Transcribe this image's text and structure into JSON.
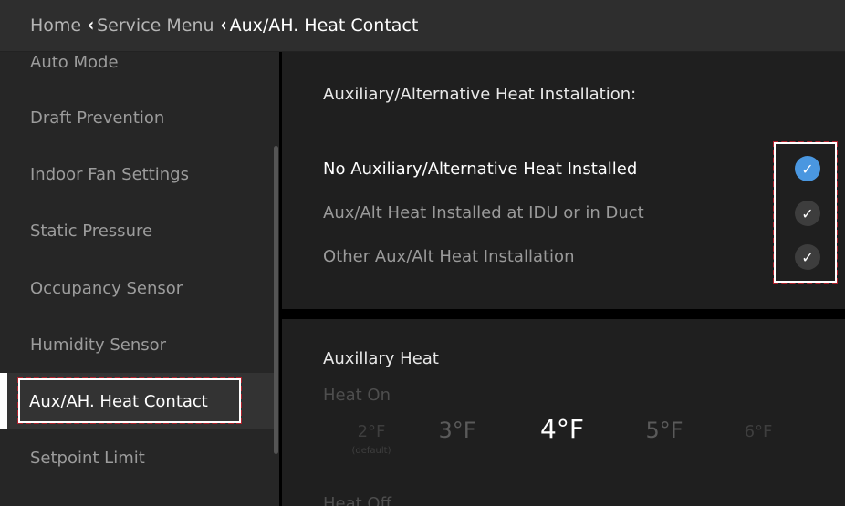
{
  "header": {
    "breadcrumbs": [
      "Home",
      "Service Menu",
      "Aux/AH. Heat Contact"
    ],
    "separator_icon": "chevron-left-icon"
  },
  "sidebar": {
    "items": [
      {
        "label": "Auto Mode"
      },
      {
        "label": "Draft Prevention"
      },
      {
        "label": "Indoor Fan Settings"
      },
      {
        "label": "Static Pressure"
      },
      {
        "label": "Occupancy Sensor"
      },
      {
        "label": "Humidity Sensor"
      },
      {
        "label": "Aux/AH. Heat Contact",
        "active": true
      },
      {
        "label": "Setpoint Limit"
      }
    ]
  },
  "installation": {
    "title": "Auxiliary/Alternative Heat Installation:",
    "options": [
      {
        "label": "No Auxiliary/Alternative Heat Installed",
        "selected": true
      },
      {
        "label": "Aux/Alt Heat Installed at IDU or in Duct",
        "selected": false
      },
      {
        "label": "Other Aux/Alt Heat Installation",
        "selected": false
      }
    ]
  },
  "aux_heat": {
    "title": "Auxillary Heat",
    "heat_on_label": "Heat On",
    "heat_off_label": "Heat Off",
    "temps": [
      "2°F",
      "3°F",
      "4°F",
      "5°F",
      "6°F"
    ],
    "default_note": "(default)",
    "selected_temp": "4°F"
  },
  "colors": {
    "accent": "#4a97e0",
    "annotation": "#b01f2a"
  }
}
